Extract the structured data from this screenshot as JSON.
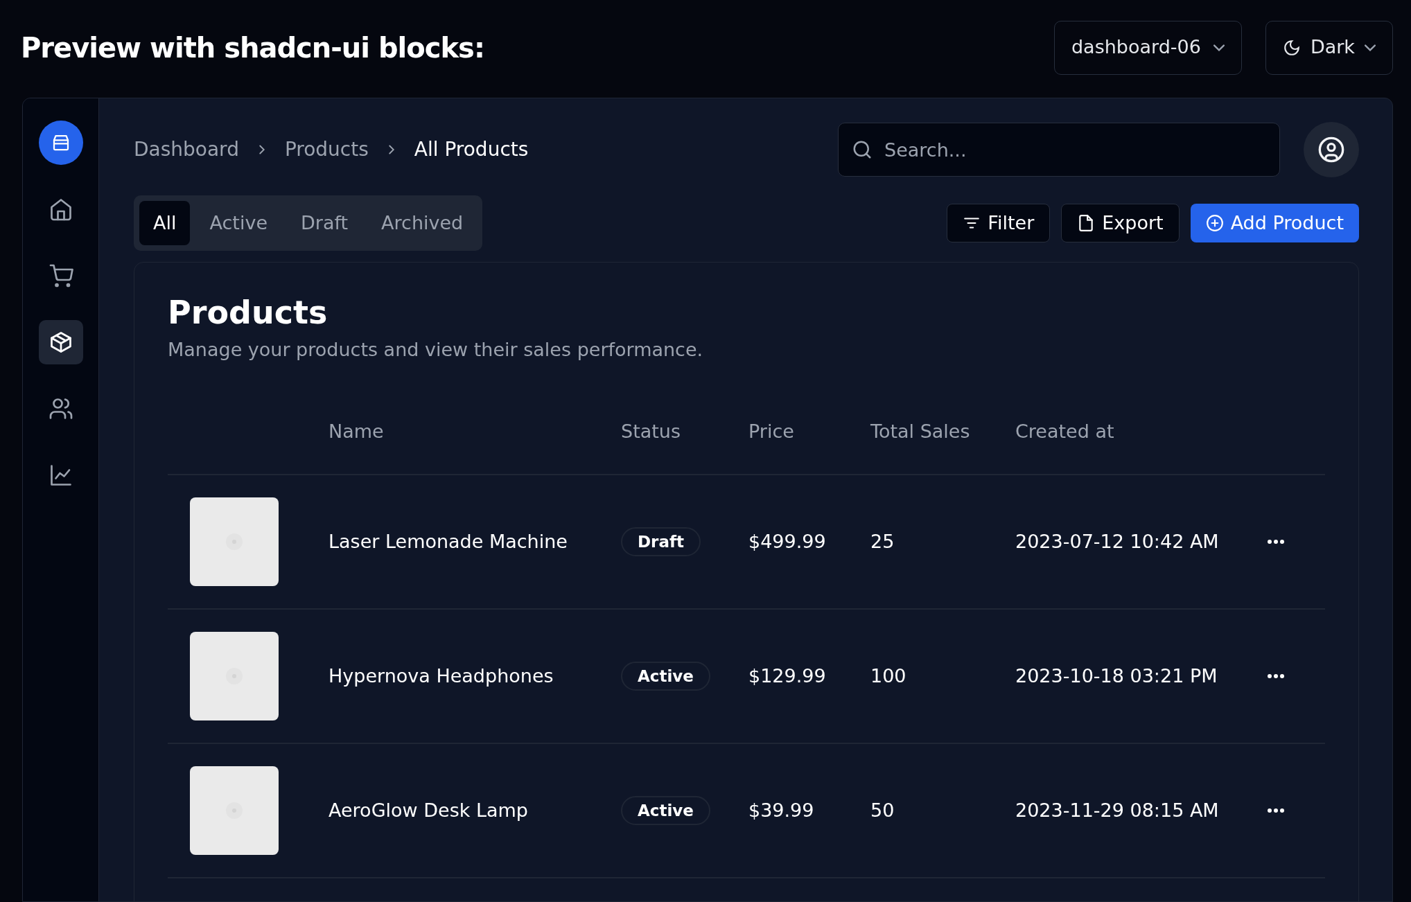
{
  "header": {
    "title": "Preview with shadcn-ui blocks:",
    "block_select": "dashboard-06",
    "theme_select": "Dark"
  },
  "sidebar": {
    "items": [
      {
        "kind": "home",
        "selected": false
      },
      {
        "kind": "cart",
        "selected": false
      },
      {
        "kind": "package",
        "selected": true
      },
      {
        "kind": "users",
        "selected": false
      },
      {
        "kind": "chart",
        "selected": false
      }
    ]
  },
  "breadcrumb": [
    "Dashboard",
    "Products",
    "All Products"
  ],
  "search": {
    "placeholder": "Search..."
  },
  "tabs": [
    {
      "label": "All",
      "selected": true
    },
    {
      "label": "Active",
      "selected": false
    },
    {
      "label": "Draft",
      "selected": false
    },
    {
      "label": "Archived",
      "selected": false
    }
  ],
  "actions": [
    {
      "kind": "filter",
      "label": "Filter"
    },
    {
      "kind": "export",
      "label": "Export"
    },
    {
      "kind": "add",
      "label": "Add Product"
    }
  ],
  "card": {
    "title": "Products",
    "description": "Manage your products and view their sales performance.",
    "table": {
      "columns": [
        "Name",
        "Status",
        "Price",
        "Total Sales",
        "Created at"
      ],
      "rows": [
        {
          "name": "Laser Lemonade Machine",
          "status": "Draft",
          "price": "$499.99",
          "total_sales": "25",
          "created_at": "2023-07-12 10:42 AM"
        },
        {
          "name": "Hypernova Headphones",
          "status": "Active",
          "price": "$129.99",
          "total_sales": "100",
          "created_at": "2023-10-18 03:21 PM"
        },
        {
          "name": "AeroGlow Desk Lamp",
          "status": "Active",
          "price": "$39.99",
          "total_sales": "50",
          "created_at": "2023-11-29 08:15 AM"
        }
      ]
    }
  }
}
